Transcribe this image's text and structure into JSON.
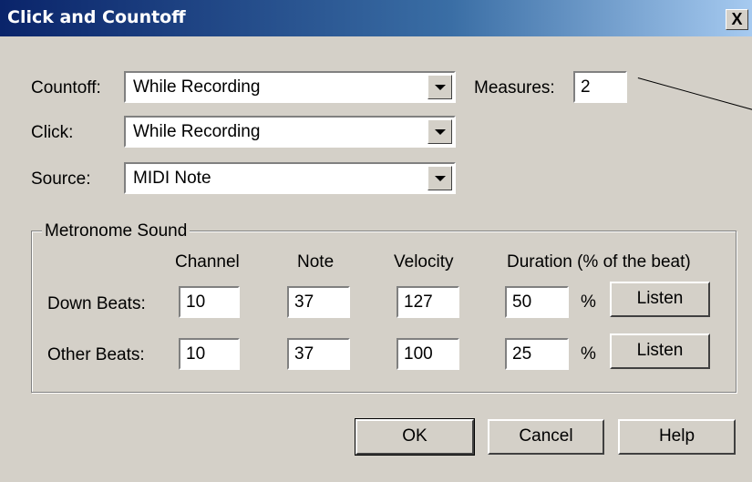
{
  "window": {
    "title": "Click and Countoff",
    "close_label": "X"
  },
  "countoff": {
    "label": "Countoff:",
    "value": "While Recording"
  },
  "click": {
    "label": "Click:",
    "value": "While Recording"
  },
  "source": {
    "label": "Source:",
    "value": "MIDI Note"
  },
  "measures": {
    "label": "Measures:",
    "value": "2"
  },
  "metronome": {
    "title": "Metronome Sound",
    "headers": {
      "channel": "Channel",
      "note": "Note",
      "velocity": "Velocity",
      "duration": "Duration (% of the beat)"
    },
    "rows": [
      {
        "label": "Down Beats:",
        "channel": "10",
        "note": "37",
        "velocity": "127",
        "duration": "50",
        "unit": "%",
        "listen": "Listen"
      },
      {
        "label": "Other Beats:",
        "channel": "10",
        "note": "37",
        "velocity": "100",
        "duration": "25",
        "unit": "%",
        "listen": "Listen"
      }
    ]
  },
  "buttons": {
    "ok": "OK",
    "cancel": "Cancel",
    "help": "Help"
  }
}
